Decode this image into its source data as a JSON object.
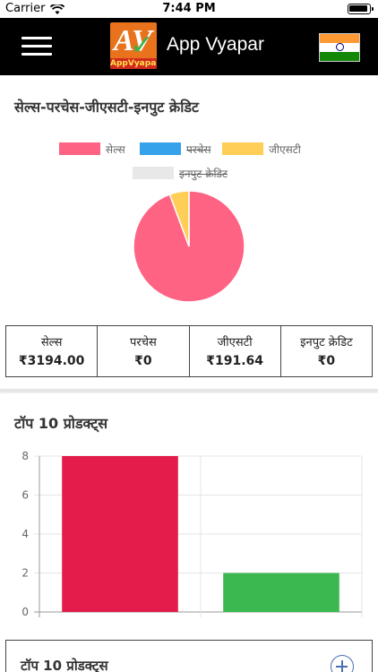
{
  "status_bar": {
    "carrier": "Carrier",
    "time": "7:44 PM"
  },
  "header": {
    "title": "App Vyapar",
    "logo_text": "AppVyapar",
    "logo_letters": "AV",
    "flag": "india-flag"
  },
  "summary_section": {
    "title": "सेल्स-परचेस-जीएसटी-इनपुट क्रेडिट",
    "legend": [
      {
        "label": "सेल्स",
        "color": "#ff6384",
        "hidden": false
      },
      {
        "label": "परचेस",
        "color": "#36a2eb",
        "hidden": true
      },
      {
        "label": "जीएसटी",
        "color": "#ffce56",
        "hidden": false
      },
      {
        "label": "इनपुट क्रेडिट",
        "color": "#e8e8e8",
        "hidden": true
      }
    ],
    "cells": [
      {
        "label": "सेल्स",
        "value": "₹3194.00"
      },
      {
        "label": "परचेस",
        "value": "₹0"
      },
      {
        "label": "जीएसटी",
        "value": "₹191.64"
      },
      {
        "label": "इनपुट क्रेडिट",
        "value": "₹0"
      }
    ]
  },
  "top_products": {
    "title": "टॉप 10 प्रोडक्ट्स",
    "card_title": "टॉप 10 प्रोडक्ट्स"
  },
  "chart_data": [
    {
      "type": "pie",
      "categories": [
        "सेल्स",
        "परचेस",
        "जीएसटी",
        "इनपुट क्रेडिट"
      ],
      "values": [
        3194.0,
        0,
        191.64,
        0
      ],
      "colors": [
        "#ff6384",
        "#36a2eb",
        "#ffce56",
        "#e8e8e8"
      ],
      "hidden_series": [
        "परचेस",
        "इनपुट क्रेडिट"
      ],
      "legend_position": "top"
    },
    {
      "type": "bar",
      "categories": [
        "",
        ""
      ],
      "values": [
        8,
        2
      ],
      "colors": [
        "#e31c4b",
        "#3cb850"
      ],
      "ylim": [
        0,
        8
      ],
      "yticks": [
        0,
        2,
        4,
        6,
        8
      ],
      "grid": true
    }
  ]
}
